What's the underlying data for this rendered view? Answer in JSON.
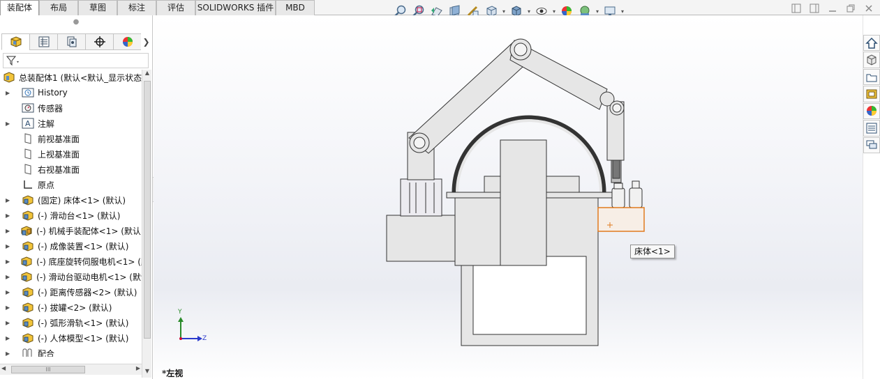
{
  "tabs": [
    "装配体",
    "布局",
    "草图",
    "标注",
    "评估",
    "SOLIDWORKS 插件",
    "MBD"
  ],
  "active_tab": 0,
  "hud_icons": [
    "zoom-to-fit-icon",
    "zoom-to-area-icon",
    "previous-view-icon",
    "section-view-icon",
    "dynamic-annotation-icon",
    "view-orientation-icon",
    "display-style-icon",
    "hide-show-items-icon",
    "edit-appearance-icon",
    "apply-scene-icon",
    "view-settings-icon"
  ],
  "manager_tabs": [
    "featuremanager-icon",
    "propertymanager-icon",
    "configurationmanager-icon",
    "dimxpertmanager-icon",
    "displaymanager-icon"
  ],
  "tree": {
    "root": "总装配体1 (默认<默认_显示状态",
    "items": [
      {
        "label": "History",
        "icon": "history-icon",
        "expand": true
      },
      {
        "label": "传感器",
        "icon": "sensor-icon",
        "expand": false
      },
      {
        "label": "注解",
        "icon": "annotation-icon",
        "expand": true
      },
      {
        "label": "前视基准面",
        "icon": "plane-icon",
        "expand": false
      },
      {
        "label": "上视基准面",
        "icon": "plane-icon",
        "expand": false
      },
      {
        "label": "右视基准面",
        "icon": "plane-icon",
        "expand": false
      },
      {
        "label": "原点",
        "icon": "origin-icon",
        "expand": false
      },
      {
        "label": "(固定) 床体<1> (默认)",
        "icon": "part-icon",
        "expand": true
      },
      {
        "label": "(-) 滑动台<1> (默认)",
        "icon": "part-icon",
        "expand": true
      },
      {
        "label": "(-) 机械手装配体<1> (默认<",
        "icon": "subassembly-icon",
        "expand": true
      },
      {
        "label": "(-) 成像装置<1> (默认)",
        "icon": "part-icon",
        "expand": true
      },
      {
        "label": "(-) 底座旋转伺服电机<1> (默",
        "icon": "part-icon",
        "expand": true
      },
      {
        "label": "(-) 滑动台驱动电机<1> (默认",
        "icon": "part-icon",
        "expand": true
      },
      {
        "label": "(-) 距离传感器<2> (默认)",
        "icon": "part-icon",
        "expand": true
      },
      {
        "label": "(-) 拔罐<2> (默认)",
        "icon": "part-icon",
        "expand": true
      },
      {
        "label": "(-) 弧形滑轨<1> (默认)",
        "icon": "part-icon",
        "expand": true
      },
      {
        "label": "(-) 人体模型<1> (默认)",
        "icon": "part-icon",
        "expand": true
      },
      {
        "label": "配合",
        "icon": "mates-icon",
        "expand": true
      }
    ]
  },
  "hscroll_grip": "III",
  "tooltip": "床体<1>",
  "view_name": "*左视",
  "triad": {
    "y": "Y",
    "z": "Z"
  },
  "task_pane": [
    "home-icon",
    "design-library-icon",
    "file-explorer-icon",
    "view-palette-icon",
    "appearances-icon",
    "custom-properties-icon",
    "forum-icon"
  ],
  "colors": {
    "selection": "#e07a1f",
    "part": "#e6e6e6",
    "outline": "#333333"
  }
}
